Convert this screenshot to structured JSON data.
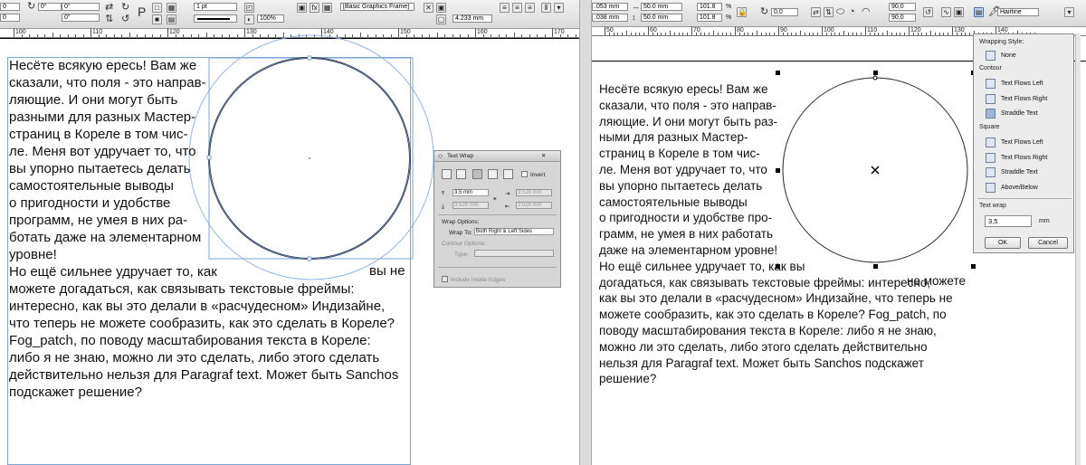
{
  "indesign": {
    "toolbar": {
      "x_value": "0",
      "y_value": "0°",
      "rotate_value": "0°",
      "stroke_weight": "1 pt",
      "scale_percent": "100%",
      "object_style": "[Basic Graphics Frame]",
      "dim_value": "4.233 mm",
      "ruler_ticks": [
        "100",
        "110",
        "120",
        "130",
        "140",
        "150",
        "160",
        "170"
      ]
    },
    "text_lines": [
      "    Несёте всякую ересь! Вам же",
      "сказали, что поля - это направ-",
      "ляющие. И они могут быть",
      "разными для разных Мастер-",
      "страниц в Кореле в том чис-",
      "ле. Меня вот удручает то, что",
      "вы упорно пытаетесь делать",
      "самостоятельные выводы",
      "о пригодности и удобстве",
      "программ, не умея в них ра-",
      "ботать даже на элементарном",
      "уровне!",
      "    Но ещё сильнее удручает то, как",
      "можете догадаться, как связывать текстовые фреймы:",
      "интересно, как вы это делали в «расчудесном» Индизайне,",
      "что теперь не можете сообразить, как это сделать в Кореле?",
      "Fog_patch, по поводу масштабирования текста в Кореле:",
      "либо я не знаю, можно ли это сделать, либо этого сделать",
      "действительно нельзя для Paragraf text. Может быть Sanchos",
      "подскажет решение?"
    ],
    "text_line_tail": "вы не",
    "text_wrap_panel": {
      "title": "Text Wrap",
      "invert_label": "Invert",
      "offset_top": "3.5 mm",
      "offset_other": "3.528 mm",
      "wrap_options_label": "Wrap Options:",
      "wrap_to_label": "Wrap To:",
      "wrap_to_value": "Both Right & Left Sides",
      "contour_options_label": "Contour Options:",
      "type_label": "Type:",
      "include_inside_edges": "Include Inside Edges"
    }
  },
  "corel": {
    "toolbar": {
      "x_value": ".053 mm",
      "y_value": ".038 mm",
      "w_value": "50.0 mm",
      "h_value": "50.0 mm",
      "scale_x": "101.8",
      "scale_y": "101.8",
      "pct": "%",
      "angle": "0,0",
      "arc_start": "90,0",
      "arc_end": "90,0",
      "outline": "Hairline",
      "ruler_ticks": [
        "50",
        "60",
        "70",
        "80",
        "90",
        "100",
        "110",
        "120",
        "130",
        "140"
      ]
    },
    "text_lines": [
      "    Несёте всякую ересь! Вам же",
      "сказали, что поля - это направ-",
      "ляющие. И они могут быть раз-",
      "ными для разных Мастер-",
      "страниц в Кореле в том чис-",
      "ле. Меня вот удручает то, что",
      "вы упорно пытаетесь делать",
      "самостоятельные выводы",
      "о пригодности и удобстве про-",
      "грамм, не умея в них работать",
      "даже на элементарном уровне!",
      "    Но ещё сильнее удручает то, как вы",
      "догадаться, как связывать текстовые фреймы: интересно,",
      "как вы это делали в «расчудесном» Индизайне, что теперь не",
      "можете сообразить, как это сделать в Кореле?  Fog_patch, по",
      "поводу масштабирования текста в Кореле: либо я не знаю,",
      "можно ли это сделать, либо этого сделать действительно",
      "нельзя для Paragraf text. Может быть Sanchos подскажет",
      "решение?"
    ],
    "text_line_tail": "не можете",
    "wrap_popup": {
      "wrapping_style_label": "Wrapping Style:",
      "none_label": "None",
      "contour_label": "Contour",
      "contour_items": [
        "Text Flows Left",
        "Text Flows Right",
        "Straddle Text"
      ],
      "square_label": "Square",
      "square_items": [
        "Text Flows Left",
        "Text Flows Right",
        "Straddle Text",
        "Above/Below"
      ],
      "text_wrap_label": "Text wrap",
      "text_wrap_value": "3,5",
      "unit": "mm",
      "ok_label": "OK",
      "cancel_label": "Cancel"
    }
  }
}
